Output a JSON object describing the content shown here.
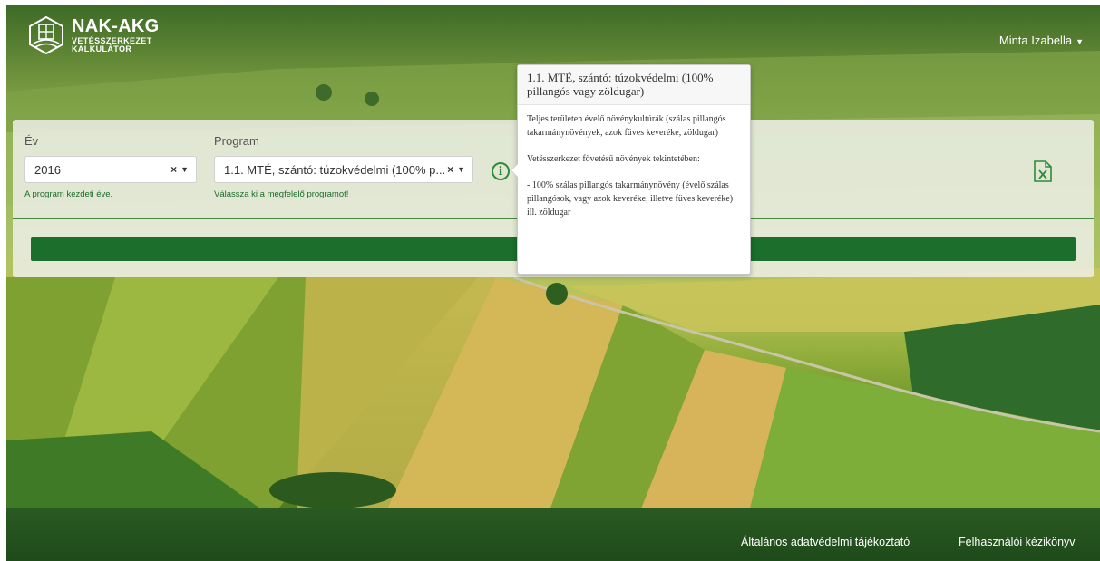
{
  "header": {
    "logo_title": "NAK-AKG",
    "logo_subtitle_1": "VETÉSSZERKEZET",
    "logo_subtitle_2": "KALKULÁTOR",
    "user_name": "Minta Izabella"
  },
  "form": {
    "year_label": "Év",
    "year_value": "2016",
    "year_hint": "A program kezdeti éve.",
    "program_label": "Program",
    "program_value": "1.1. MTÉ, szántó: túzokvédelmi (100% p...",
    "program_hint": "Válassza ki a megfelelő programot!",
    "clear_glyph": "×",
    "dropdown_glyph": "▼",
    "info_glyph": "i",
    "add_glyph": "+"
  },
  "tooltip": {
    "title": "1.1. MTÉ, szántó: túzokvédelmi (100% pillangós vagy zöldugar)",
    "para1": "Teljes területen évelő növénykultúrák (szálas pillangós takarmánynövények, azok füves keveréke, zöldugar)",
    "para2": "Vetésszerkezet fővetésű növények tekintetében:",
    "para3": "- 100% szálas pillangós takarmánynövény (évelő szálas pillangósok, vagy azok keveréke, illetve füves keveréke) ill. zöldugar"
  },
  "footer": {
    "privacy_link": "Általános adatvédelmi tájékoztató",
    "manual_link": "Felhasználói kézikönyv"
  },
  "colors": {
    "primary_green": "#1b6e2c",
    "accent_green": "#2e8b3a"
  },
  "icons": {
    "logo": "calculator-field-icon",
    "user_caret": "caret-down-icon",
    "info": "info-circle-icon",
    "export": "excel-file-icon",
    "add": "plus-icon"
  }
}
